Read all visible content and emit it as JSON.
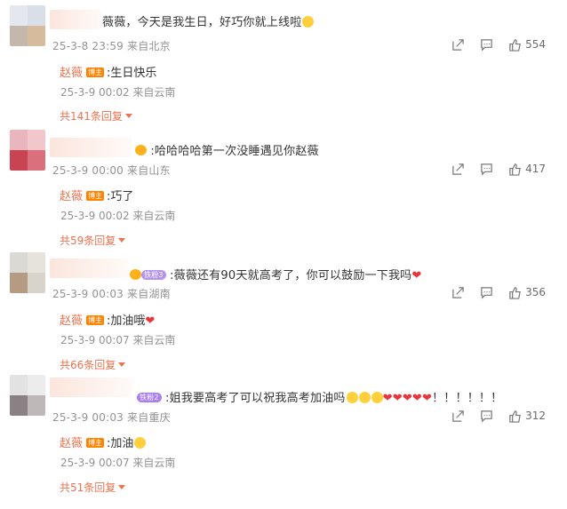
{
  "comments": [
    {
      "text": "薇薇，今天是我生日，好巧你就上线啦",
      "meta": "25-3-8 23:59 来自北京",
      "likes": "554",
      "reply": {
        "name": "赵薇",
        "badge": "博主",
        "text": ":生日快乐",
        "meta": "25-3-9 00:02 来自云南"
      },
      "more": "共141条回复"
    },
    {
      "text": ":哈哈哈哈第一次没睡遇见你赵薇",
      "meta": "25-3-9 00:00 来自山东",
      "likes": "417",
      "reply": {
        "name": "赵薇",
        "badge": "博主",
        "text": ":巧了",
        "meta": "25-3-9 00:02 来自云南"
      },
      "more": "共59条回复"
    },
    {
      "text": ":薇薇还有90天就高考了，你可以鼓励一下我吗",
      "fan_badge": "铁粉3",
      "meta": "25-3-9 00:03 来自湖南",
      "likes": "356",
      "reply": {
        "name": "赵薇",
        "badge": "博主",
        "text": ":加油哦",
        "meta": "25-3-9 00:07 来自云南"
      },
      "more": "共66条回复"
    },
    {
      "text": ":姐我要高考了可以祝我高考加油吗",
      "text_tail": "！！！！！！",
      "fan_badge": "铁粉2",
      "meta": "25-3-9 00:03 来自重庆",
      "likes": "312",
      "reply": {
        "name": "赵薇",
        "badge": "博主",
        "text": ":加油",
        "meta": "25-3-9 00:07 来自云南"
      },
      "more": "共51条回复"
    }
  ],
  "icons": {
    "share": "share-icon",
    "comment": "comment-icon",
    "like": "thumbs-up-icon",
    "expand": "caret-down-icon"
  },
  "colors": {
    "accent": "#eb7350",
    "blogger_badge": "#ff8200",
    "heart": "#e8353c",
    "meta": "#939393"
  }
}
